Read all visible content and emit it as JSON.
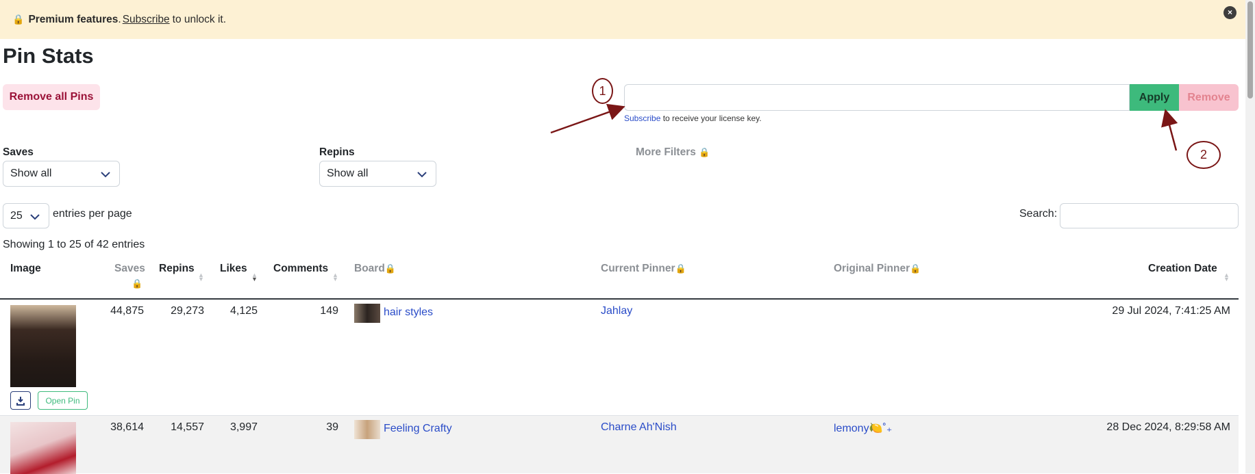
{
  "banner": {
    "lock_icon": "🔒",
    "premium_label": "Premium features",
    "dot": ".",
    "subscribe_link": "Subscribe",
    "suffix": "to unlock it.",
    "close_icon": "×"
  },
  "page": {
    "title": "Pin Stats"
  },
  "toolbar": {
    "remove_all_label": "Remove all Pins"
  },
  "license": {
    "input_value": "",
    "apply_label": "Apply",
    "remove_label": "Remove",
    "note_link": "Subscribe",
    "note_text": "to receive your license key."
  },
  "annotations": {
    "callout_1": "1",
    "callout_2": "2",
    "arrow_color": "#7a1616"
  },
  "filters": {
    "saves": {
      "label": "Saves",
      "value": "Show all"
    },
    "repins": {
      "label": "Repins",
      "value": "Show all"
    },
    "more": {
      "label": "More Filters",
      "lock_icon": "🔒"
    }
  },
  "table_controls": {
    "page_length": "25",
    "entries_label": "entries per page",
    "search_label": "Search:",
    "search_value": "",
    "info": "Showing 1 to 25 of 42 entries"
  },
  "columns": {
    "image": "Image",
    "saves": "Saves",
    "repins": "Repins",
    "likes": "Likes",
    "comments": "Comments",
    "board": "Board",
    "current_pinner": "Current Pinner",
    "original_pinner": "Original Pinner",
    "creation_date": "Creation Date",
    "lock_icon": "🔒"
  },
  "rows": [
    {
      "saves": "44,875",
      "repins": "29,273",
      "likes": "4,125",
      "comments": "149",
      "board": "hair styles",
      "current_pinner": "Jahlay",
      "original_pinner": "",
      "creation_date": "29 Jul 2024, 7:41:25 AM",
      "open_pin_label": "Open Pin"
    },
    {
      "saves": "38,614",
      "repins": "14,557",
      "likes": "3,997",
      "comments": "39",
      "board": "Feeling Crafty",
      "current_pinner": "Charne Ah'Nish",
      "original_pinner": "lemony🍋˚₊",
      "creation_date": "28 Dec 2024, 8:29:58 AM"
    }
  ],
  "colors": {
    "banner_bg": "#fdf1d4",
    "apply_green": "#3dba7c",
    "remove_pink": "#f8c3cf",
    "link_blue": "#2a4cc8",
    "danger_text": "#9b1238"
  }
}
